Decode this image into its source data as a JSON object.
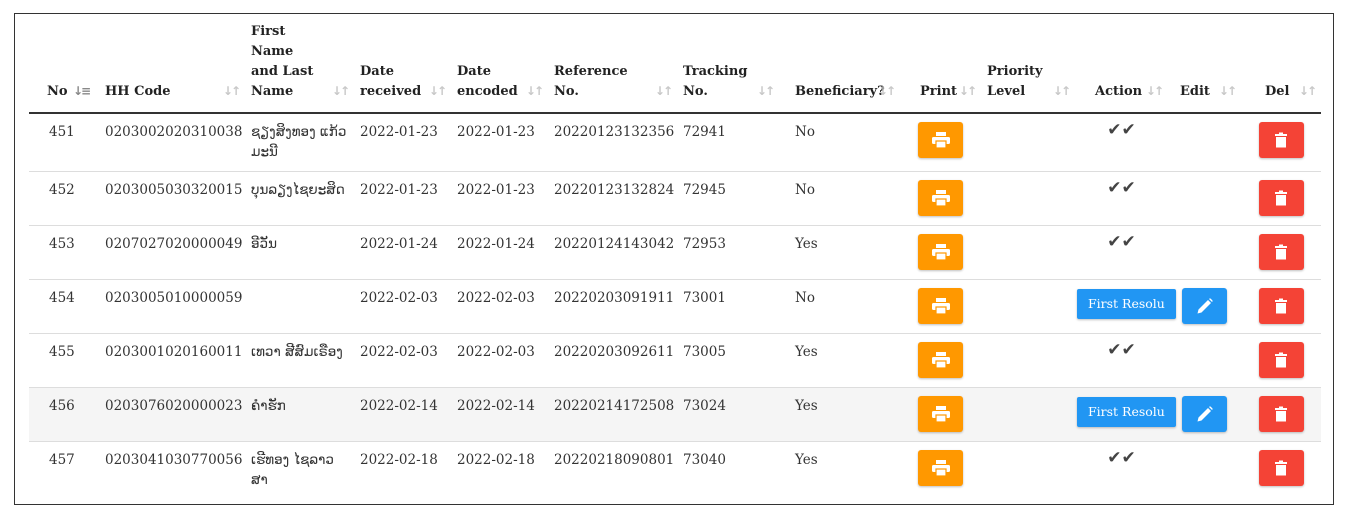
{
  "columns": {
    "no": "No",
    "hh_code": "HH Code",
    "name": "First Name and Last Name",
    "date_received": "Date received",
    "date_encoded": "Date encoded",
    "reference_no": "Reference No.",
    "tracking_no": "Tracking No.",
    "beneficiary": "Beneficiary?",
    "print": "Print",
    "priority_level": "Priority Level",
    "action": "Action",
    "edit": "Edit",
    "del": "Del"
  },
  "rows": [
    {
      "no": "451",
      "hh_code": "0203002020310038",
      "name": "ຊຽງສິງທອງ ແກ້ວມະນີ",
      "date_received": "2022-01-23",
      "date_encoded": "2022-01-23",
      "reference_no": "20220123132356",
      "tracking_no": "72941",
      "beneficiary": "No",
      "action_type": "check",
      "action_label": "✔✔"
    },
    {
      "no": "452",
      "hh_code": "0203005030320015",
      "name": "ບຸນລຽງໄຊຍະສິດ",
      "date_received": "2022-01-23",
      "date_encoded": "2022-01-23",
      "reference_no": "20220123132824",
      "tracking_no": "72945",
      "beneficiary": "No",
      "action_type": "check",
      "action_label": "✔✔"
    },
    {
      "no": "453",
      "hh_code": "0207027020000049",
      "name": "ອີວັນ",
      "date_received": "2022-01-24",
      "date_encoded": "2022-01-24",
      "reference_no": "20220124143042",
      "tracking_no": "72953",
      "beneficiary": "Yes",
      "action_type": "check",
      "action_label": "✔✔"
    },
    {
      "no": "454",
      "hh_code": "0203005010000059",
      "name": "",
      "date_received": "2022-02-03",
      "date_encoded": "2022-02-03",
      "reference_no": "20220203091911",
      "tracking_no": "73001",
      "beneficiary": "No",
      "action_type": "button",
      "action_label": "First Resolu"
    },
    {
      "no": "455",
      "hh_code": "0203001020160011",
      "name": "ເທວາ ສີສົມເຣືອງ",
      "date_received": "2022-02-03",
      "date_encoded": "2022-02-03",
      "reference_no": "20220203092611",
      "tracking_no": "73005",
      "beneficiary": "Yes",
      "action_type": "check",
      "action_label": "✔✔"
    },
    {
      "no": "456",
      "hh_code": "0203076020000023",
      "name": "ຄຳຮັກ",
      "date_received": "2022-02-14",
      "date_encoded": "2022-02-14",
      "reference_no": "20220214172508",
      "tracking_no": "73024",
      "beneficiary": "Yes",
      "action_type": "button",
      "action_label": "First Resolu"
    },
    {
      "no": "457",
      "hh_code": "0203041030770056",
      "name": "ເຮີທອງ ໄຊລາວສາ",
      "date_received": "2022-02-18",
      "date_encoded": "2022-02-18",
      "reference_no": "20220218090801",
      "tracking_no": "73040",
      "beneficiary": "Yes",
      "action_type": "check",
      "action_label": "✔✔"
    }
  ],
  "colors": {
    "print": "#ff9800",
    "edit": "#2196f3",
    "delete": "#f44336",
    "action_button": "#2196f3"
  },
  "icons": {
    "print": "printer-icon",
    "edit": "pencil-icon",
    "delete": "trash-icon",
    "action": "double-check-icon",
    "sort": "sort-icon"
  }
}
